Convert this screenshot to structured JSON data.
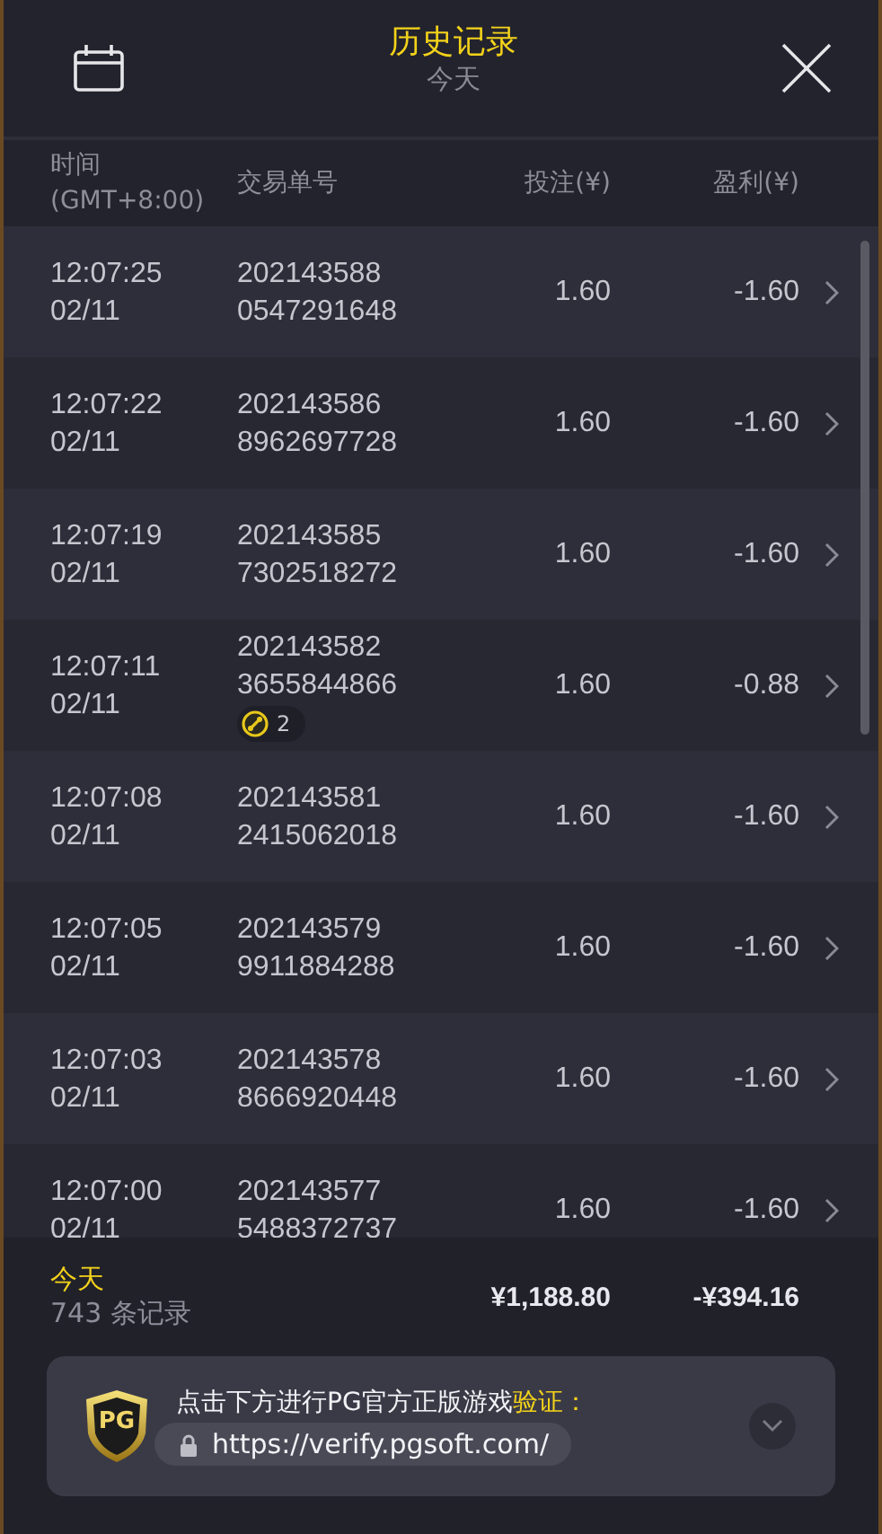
{
  "header": {
    "title": "历史记录",
    "subtitle": "今天"
  },
  "columns": [
    "时间\n(GMT+8:00)",
    "交易单号",
    "投注(¥)",
    "盈利(¥)"
  ],
  "rows": [
    {
      "time": "12:07:25",
      "date": "02/11",
      "id_1": "202143588",
      "id_2": "0547291648",
      "bet": "1.60",
      "profit": "-1.60"
    },
    {
      "time": "12:07:22",
      "date": "02/11",
      "id_1": "202143586",
      "id_2": "8962697728",
      "bet": "1.60",
      "profit": "-1.60"
    },
    {
      "time": "12:07:19",
      "date": "02/11",
      "id_1": "202143585",
      "id_2": "7302518272",
      "bet": "1.60",
      "profit": "-1.60"
    },
    {
      "time": "12:07:11",
      "date": "02/11",
      "id_1": "202143582",
      "id_2": "3655844866",
      "bet": "1.60",
      "profit": "-0.88",
      "badge": "2"
    },
    {
      "time": "12:07:08",
      "date": "02/11",
      "id_1": "202143581",
      "id_2": "2415062018",
      "bet": "1.60",
      "profit": "-1.60"
    },
    {
      "time": "12:07:05",
      "date": "02/11",
      "id_1": "202143579",
      "id_2": "9911884288",
      "bet": "1.60",
      "profit": "-1.60"
    },
    {
      "time": "12:07:03",
      "date": "02/11",
      "id_1": "202143578",
      "id_2": "8666920448",
      "bet": "1.60",
      "profit": "-1.60"
    },
    {
      "time": "12:07:00",
      "date": "02/11",
      "id_1": "202143577",
      "id_2": "5488372737",
      "bet": "1.60",
      "profit": "-1.60"
    }
  ],
  "summary": {
    "period": "今天",
    "count": "743 条记录",
    "total_bet": "¥1,188.80",
    "total_profit": "-¥394.16"
  },
  "verify": {
    "logo_label": "PG",
    "message": "点击下方进行PG官方正版游戏",
    "message_highlight": "验证：",
    "url": "https://verify.pgsoft.com/"
  }
}
